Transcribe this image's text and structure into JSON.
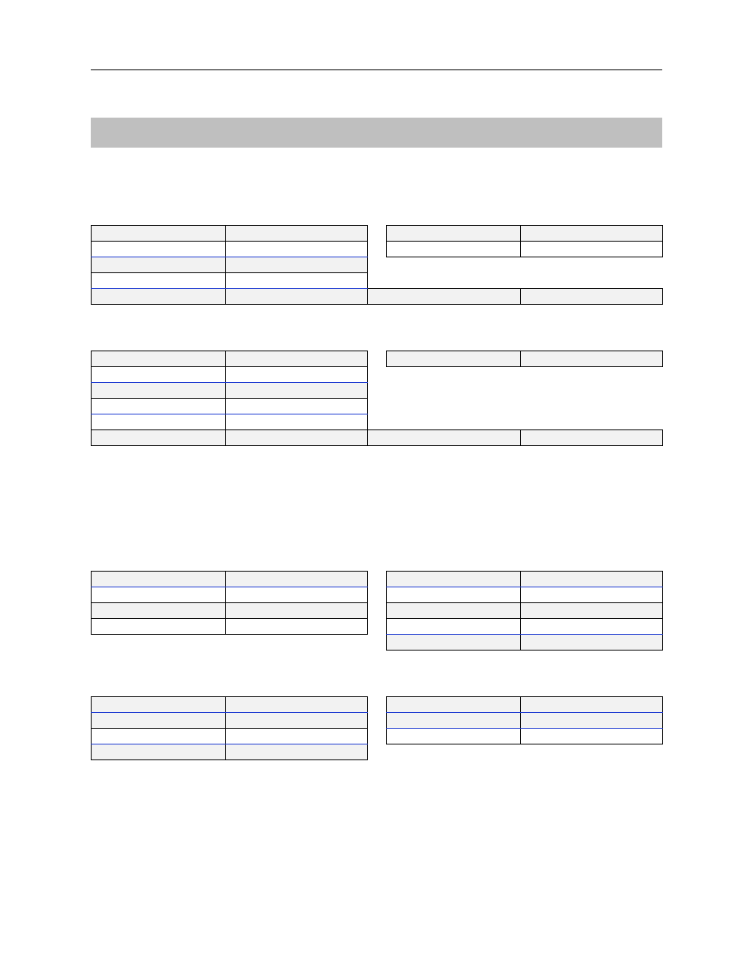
{
  "header": {
    "title": ""
  },
  "section_bar": {
    "label": ""
  },
  "block1": {
    "subsection": "",
    "group_left": "",
    "left_rows": [
      {
        "k": "",
        "v": ""
      },
      {
        "k": "",
        "v": ""
      },
      {
        "k": "",
        "v": ""
      },
      {
        "k": "",
        "v": ""
      }
    ],
    "right_rows": [
      {
        "k": "",
        "v": ""
      },
      {
        "k": "",
        "v": ""
      }
    ],
    "bottom": {
      "c1": "",
      "c2": "",
      "c3": "",
      "c4": ""
    }
  },
  "block2": {
    "group_left": "",
    "left_rows": [
      {
        "k": "",
        "v": ""
      },
      {
        "k": "",
        "v": ""
      },
      {
        "k": "",
        "v": ""
      },
      {
        "k": "",
        "v": ""
      },
      {
        "k": "",
        "v": ""
      }
    ],
    "right_rows": [
      {
        "k": "",
        "v": ""
      }
    ],
    "bottom": {
      "c1": "",
      "c2": "",
      "c3": "",
      "c4": ""
    }
  },
  "block3": {
    "subsection": "",
    "group_left": "",
    "left_rows": [
      {
        "k": "",
        "v": ""
      },
      {
        "k": "",
        "v": ""
      },
      {
        "k": "",
        "v": ""
      },
      {
        "k": "",
        "v": ""
      }
    ],
    "right_rows": [
      {
        "k": "",
        "v": ""
      },
      {
        "k": "",
        "v": ""
      },
      {
        "k": "",
        "v": ""
      },
      {
        "k": "",
        "v": ""
      },
      {
        "k": "",
        "v": ""
      }
    ]
  },
  "block4": {
    "group_left": "",
    "left_rows": [
      {
        "k": "",
        "v": ""
      },
      {
        "k": "",
        "v": ""
      },
      {
        "k": "",
        "v": ""
      },
      {
        "k": "",
        "v": ""
      }
    ],
    "right_rows": [
      {
        "k": "",
        "v": ""
      },
      {
        "k": "",
        "v": ""
      },
      {
        "k": "",
        "v": ""
      }
    ]
  }
}
